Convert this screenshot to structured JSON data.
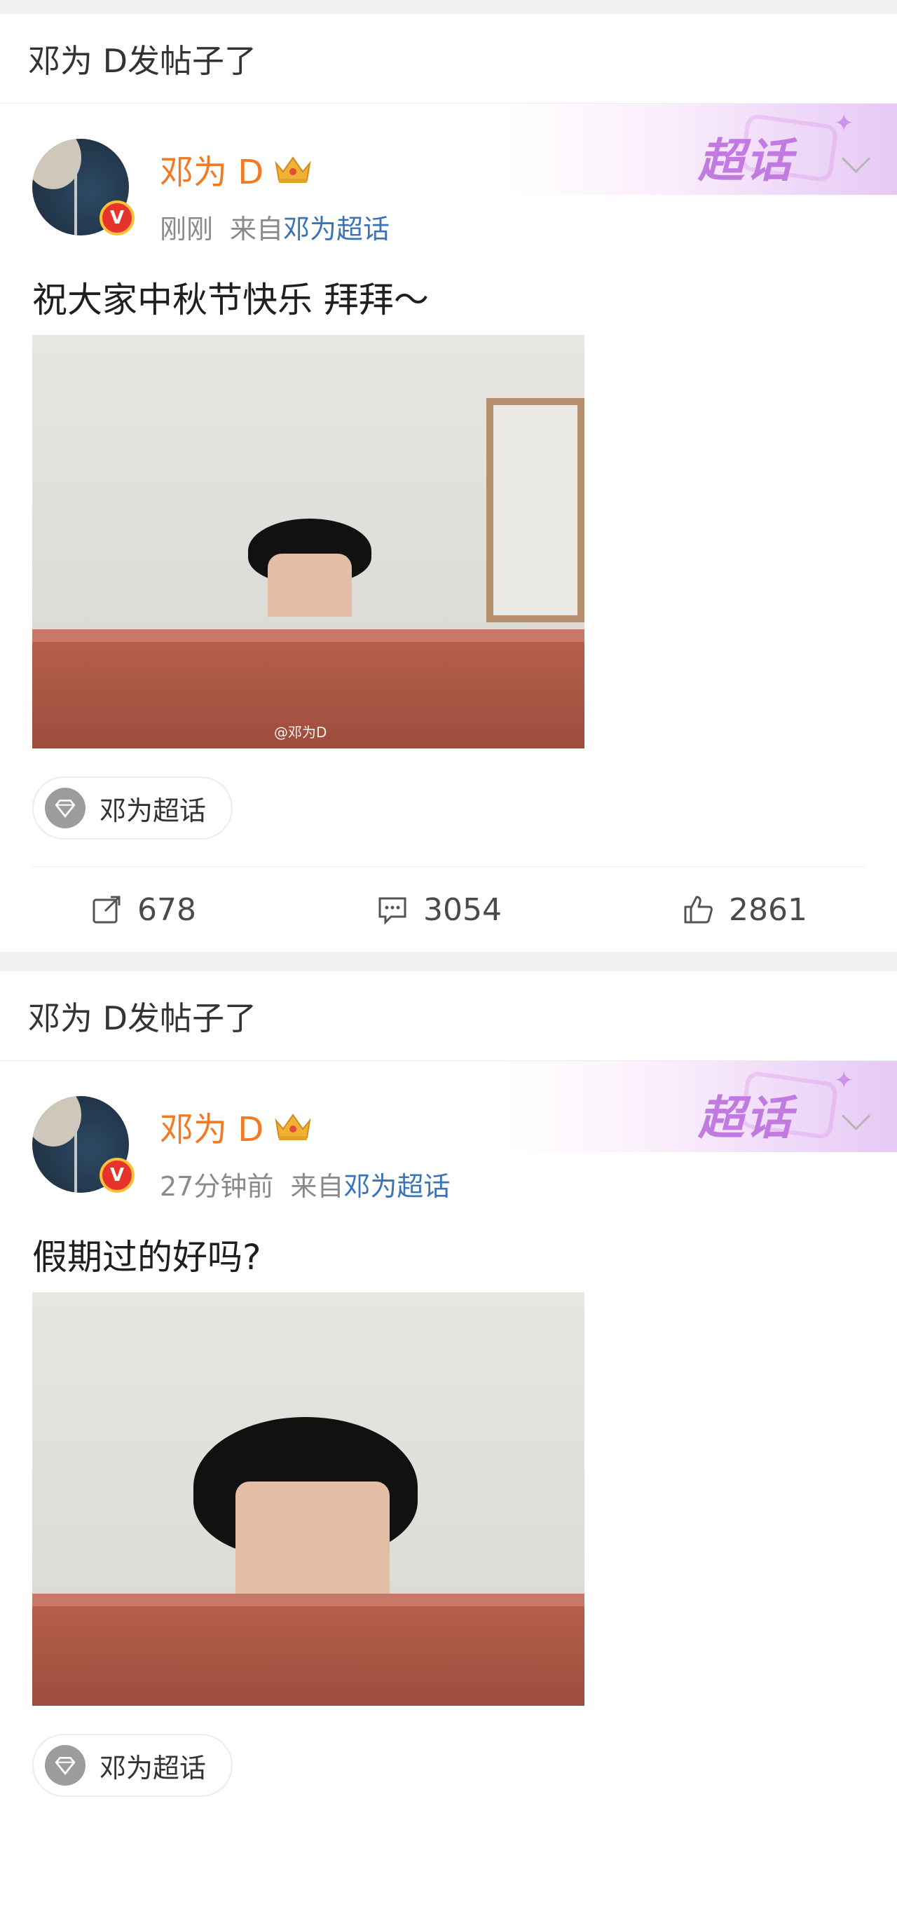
{
  "posts": [
    {
      "header": "邓为 D发帖子了",
      "chaohua_badge": "超话",
      "username": "邓为 D",
      "time": "刚刚",
      "from_label": "来自",
      "from_source": "邓为超话",
      "text": "祝大家中秋节快乐 拜拜～",
      "image_watermark": "@邓为D",
      "topic": "邓为超话",
      "reposts": "678",
      "comments": "3054",
      "likes": "2861"
    },
    {
      "header": "邓为 D发帖子了",
      "chaohua_badge": "超话",
      "username": "邓为 D",
      "time": "27分钟前",
      "from_label": "来自",
      "from_source": "邓为超话",
      "text": "假期过的好吗?",
      "topic": "邓为超话"
    }
  ],
  "colors": {
    "username": "#f07b27",
    "link": "#3a74b5",
    "chaohua": "#c07ae0"
  },
  "icons": [
    "crown-icon",
    "verified-badge-icon",
    "chevron-down-icon",
    "topic-diamond-icon",
    "repost-icon",
    "comment-icon",
    "like-icon"
  ]
}
